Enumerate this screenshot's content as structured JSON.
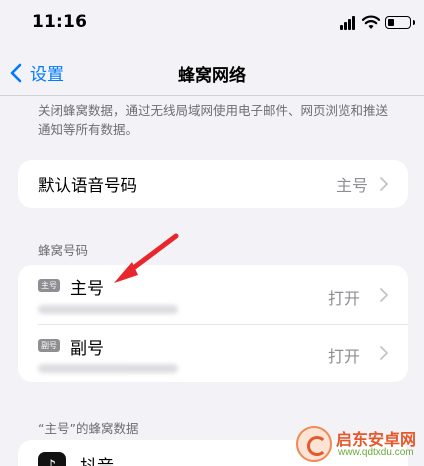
{
  "status_bar": {
    "time": "11:16"
  },
  "nav": {
    "back_label": "设置",
    "title": "蜂窝网络"
  },
  "description": "关闭蜂窝数据，通过无线局域网使用电子邮件、网页浏览和推送通知等所有数据。",
  "default_line": {
    "label": "默认语音号码",
    "value": "主号"
  },
  "cellular_section": {
    "header": "蜂窝号码",
    "lines": [
      {
        "badge": "主号",
        "name": "主号",
        "status": "打开"
      },
      {
        "badge": "副号",
        "name": "副号",
        "status": "打开"
      }
    ]
  },
  "app_section": {
    "header": "“主号”的蜂窝数据",
    "apps": [
      {
        "name": "抖音",
        "icon": "douyin-icon"
      }
    ]
  },
  "watermark": {
    "title": "启东安卓网",
    "url": "www.qdtxdu.com"
  },
  "colors": {
    "accent": "#007aff",
    "arrow": "#e8262b",
    "background": "#f2f2f7"
  }
}
